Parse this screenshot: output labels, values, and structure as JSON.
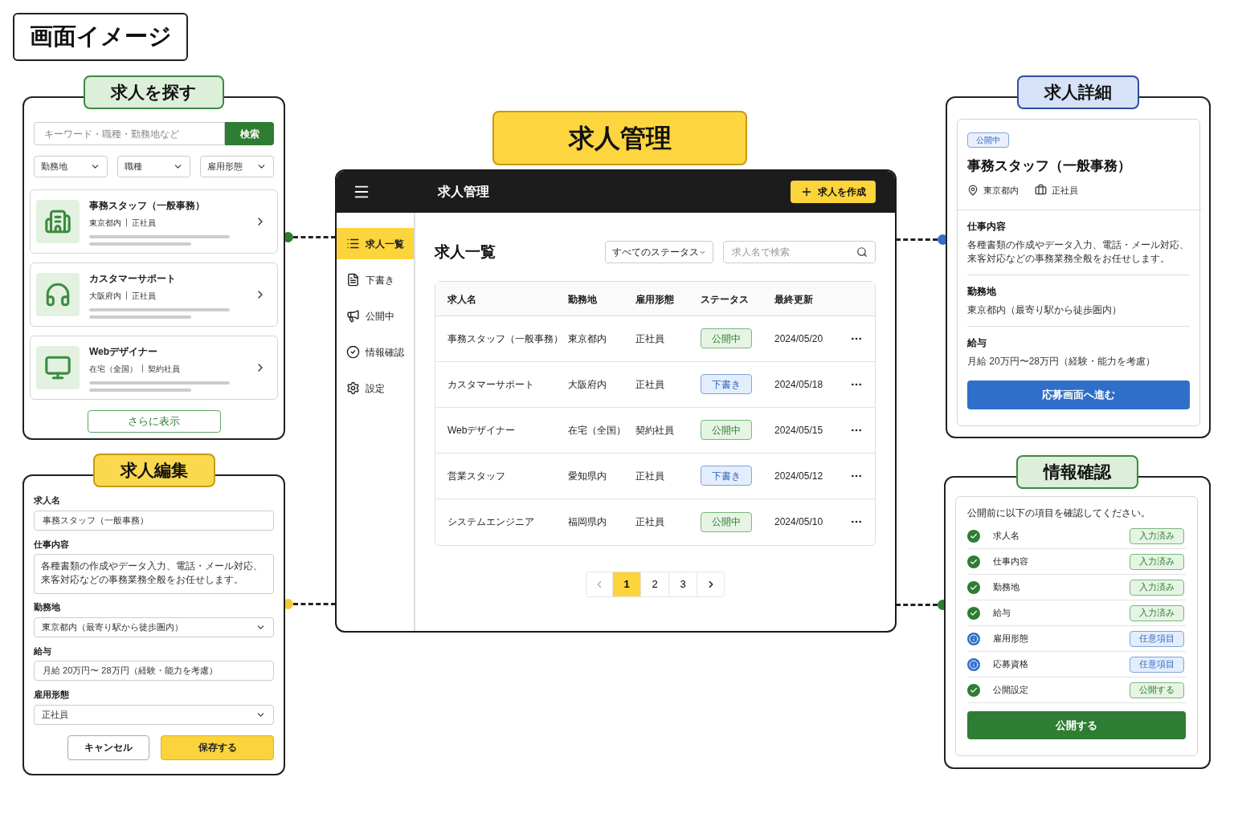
{
  "diagram_title": "画面イメージ",
  "search_screen": {
    "title": "求人を探す",
    "search": {
      "placeholder": "キーワード・職種・勤務地など",
      "button": "検索"
    },
    "filters": [
      "勤務地",
      "職種",
      "雇用形態"
    ],
    "results": [
      {
        "kind": "office",
        "title": "事務スタッフ（一般事務）",
        "location": "東京都内",
        "employment": "正社員"
      },
      {
        "kind": "support",
        "title": "カスタマーサポート",
        "location": "大阪府内",
        "employment": "正社員"
      },
      {
        "kind": "design",
        "title": "Webデザイナー",
        "location": "在宅（全国）",
        "employment": "契約社員"
      }
    ],
    "more_button": "さらに表示"
  },
  "edit_screen": {
    "title": "求人編集",
    "fields": [
      {
        "kind": "text",
        "label": "求人名",
        "value": "事務スタッフ（一般事務）"
      },
      {
        "kind": "textarea",
        "label": "仕事内容",
        "lines": [
          "各種書類の作成やデータ入力、電話・メール対応、",
          "来客対応などの事務業務全般をお任せします。"
        ]
      },
      {
        "kind": "select",
        "label": "勤務地",
        "value": "東京都内（最寄り駅から徒歩圏内）"
      },
      {
        "kind": "text",
        "label": "給与",
        "value": "月給 20万円〜 28万円（経験・能力を考慮）"
      },
      {
        "kind": "select",
        "label": "雇用形態",
        "value": "正社員"
      }
    ],
    "buttons": [
      {
        "kind": "secondary",
        "label": "キャンセル"
      },
      {
        "kind": "primary",
        "label": "保存する"
      }
    ]
  },
  "main_screen": {
    "title": "求人管理",
    "app_title": "求人管理",
    "create_button": "求人を作成",
    "nav": [
      {
        "kind": "list",
        "label": "求人一覧",
        "selected": true
      },
      {
        "kind": "draft",
        "label": "下書き",
        "selected": false
      },
      {
        "kind": "published",
        "label": "公開中",
        "selected": false
      },
      {
        "kind": "check",
        "label": "情報確認",
        "selected": false
      },
      {
        "kind": "settings",
        "label": "設定",
        "selected": false
      }
    ],
    "heading": "求人一覧",
    "status_filter": "すべてのステータス",
    "search": {
      "placeholder": "求人名で検索"
    },
    "table": {
      "columns": [
        "求人名",
        "勤務地",
        "雇用形態",
        "ステータス",
        "最終更新"
      ],
      "rows": [
        {
          "name": "事務スタッフ（一般事務）",
          "location": "東京都内",
          "employment": "正社員",
          "status": {
            "kind": "published",
            "label": "公開中"
          },
          "updated": "2024/05/20"
        },
        {
          "name": "カスタマーサポート",
          "location": "大阪府内",
          "employment": "正社員",
          "status": {
            "kind": "draft",
            "label": "下書き"
          },
          "updated": "2024/05/18"
        },
        {
          "name": "Webデザイナー",
          "location": "在宅（全国）",
          "employment": "契約社員",
          "status": {
            "kind": "published",
            "label": "公開中"
          },
          "updated": "2024/05/15"
        },
        {
          "name": "営業スタッフ",
          "location": "愛知県内",
          "employment": "正社員",
          "status": {
            "kind": "draft",
            "label": "下書き"
          },
          "updated": "2024/05/12"
        },
        {
          "name": "システムエンジニア",
          "location": "福岡県内",
          "employment": "正社員",
          "status": {
            "kind": "published",
            "label": "公開中"
          },
          "updated": "2024/05/10"
        }
      ]
    },
    "pagination": [
      {
        "label": "1",
        "selected": true
      },
      {
        "label": "2",
        "selected": false
      },
      {
        "label": "3",
        "selected": false
      }
    ]
  },
  "detail_screen": {
    "title": "求人詳細",
    "badge": "公開中",
    "job_title": "事務スタッフ（一般事務）",
    "location": "東京都内",
    "employment": "正社員",
    "sections": [
      {
        "heading": "仕事内容",
        "lines": [
          "各種書類の作成やデータ入力、電話・メール対応、",
          "来客対応などの事務業務全般をお任せします。"
        ]
      },
      {
        "heading": "勤務地",
        "lines": [
          "東京都内（最寄り駅から徒歩圏内）"
        ]
      },
      {
        "heading": "給与",
        "lines": [
          "月給 20万円〜28万円（経験・能力を考慮）"
        ]
      }
    ],
    "button": "応募画面へ進む"
  },
  "confirm_screen": {
    "title": "情報確認",
    "intro": "公開前に以下の項目を確認してください。",
    "items": [
      {
        "kind": "done",
        "label": "求人名",
        "status": "入力済み"
      },
      {
        "kind": "done",
        "label": "仕事内容",
        "status": "入力済み"
      },
      {
        "kind": "done",
        "label": "勤務地",
        "status": "入力済み"
      },
      {
        "kind": "done",
        "label": "給与",
        "status": "入力済み"
      },
      {
        "kind": "optional",
        "label": "雇用形態",
        "status": "任意項目"
      },
      {
        "kind": "optional",
        "label": "応募資格",
        "status": "任意項目"
      },
      {
        "kind": "done",
        "label": "公開設定",
        "status": "公開する"
      }
    ],
    "button": "公開する"
  }
}
